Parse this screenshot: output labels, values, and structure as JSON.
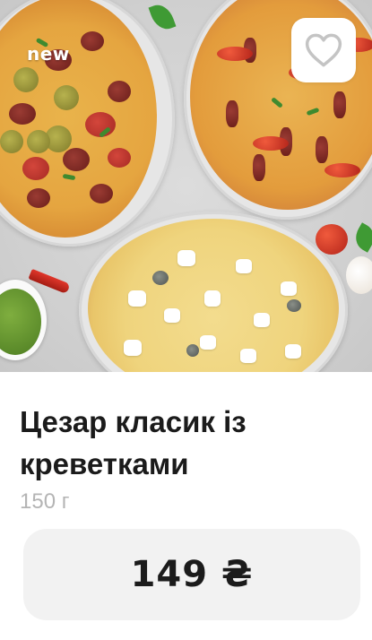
{
  "product": {
    "badge": "new",
    "name": "Цезар класик із креветками",
    "weight": "150 г",
    "price": "149 ₴"
  },
  "actions": {
    "favorite_icon": "heart-outline-icon"
  },
  "colors": {
    "title": "#1b1b1b",
    "weight": "#b4b4b4",
    "price_button_bg": "#f2f2f2",
    "badge_text": "#ffffff"
  }
}
